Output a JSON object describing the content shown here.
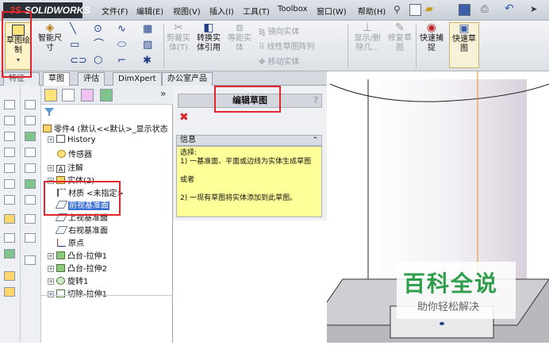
{
  "app": {
    "logo_text": "SOLIDWORKS",
    "logo_prefix": "3S"
  },
  "menu": {
    "items": [
      "文件(F)",
      "编辑(E)",
      "视图(V)",
      "插入(I)",
      "工具(T)",
      "Toolbox",
      "窗口(W)",
      "帮助(H)"
    ]
  },
  "commands": {
    "sketch": "草图绘\n制",
    "smart_dim": "智能尺\n寸",
    "trim": "剪裁实\n体(T)",
    "convert": "转换实\n体引用",
    "offset": "等距实\n体",
    "mirror": "镜向实体",
    "linear_pattern": "线性草图阵列",
    "move": "移动实体",
    "display_delete": "显示/删\n除几...",
    "repair": "修复草\n图",
    "quick_snap": "快速捕\n捉",
    "quick_sketch": "快速草\n图",
    "feature_tab": "特征"
  },
  "tabs": [
    "草图",
    "评估",
    "DimXpert",
    "办公室产品"
  ],
  "tree": {
    "root": "零件4 (默认<<默认>_显示状态",
    "nodes": {
      "history": "History",
      "sensors": "传感器",
      "annotations": "注解",
      "solids": "实体(2)",
      "material": "材质 <未指定>",
      "front_plane": "前视基准面",
      "top_plane": "上视基准面",
      "right_plane": "右视基准面",
      "origin": "原点",
      "boss1": "凸台-拉伸1",
      "boss2": "凸台-拉伸2",
      "revolve1": "旋转1",
      "cut1": "切除-拉伸1"
    }
  },
  "property_manager": {
    "title": "编辑草图",
    "help": "?",
    "info_header": "信息",
    "info_lines": [
      "选择:",
      "1) 一基准面、平面或边线为实体生成草图",
      "或者",
      "2) 一现有草图将实体添加到此草图。"
    ]
  },
  "watermark": {
    "title": "百科全说",
    "subtitle": "助你轻松解决"
  },
  "colors": {
    "highlight_red": "#e2242c",
    "selection_blue": "#3b6fd6",
    "info_yellow": "#ffff99",
    "cylinder_edge": "#f08a1c",
    "watermark_green": "#2f9e4a"
  }
}
